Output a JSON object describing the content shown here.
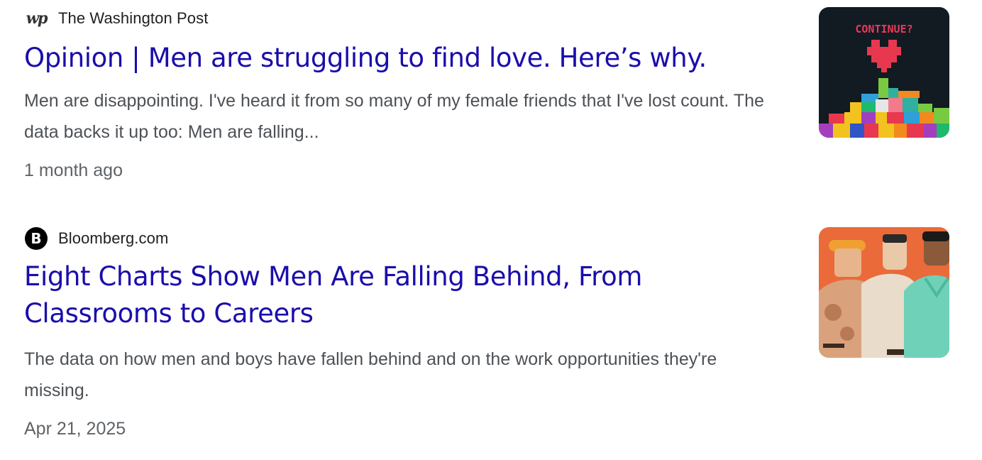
{
  "results": [
    {
      "source": "The Washington Post",
      "source_icon": "washington-post-logo",
      "headline": "Opinion | Men are struggling to find love. Here’s why.",
      "snippet": "Men are disappointing. I've heard it from so many of my female friends that I've lost count. The data backs it up too: Men are falling...",
      "date": "1 month ago",
      "thumb_text": "CONTINUE?"
    },
    {
      "source": "Bloomberg.com",
      "source_icon": "bloomberg-logo",
      "source_icon_letter": "B",
      "headline": "Eight Charts Show Men Are Falling Behind, From Classrooms to Careers",
      "snippet": "The data on how men and boys have fallen behind and on the work opportunities they're missing.",
      "date": "Apr 21, 2025"
    }
  ],
  "colors": {
    "link": "#1a0dab",
    "snippet": "#4d5156",
    "meta": "#5f6368"
  }
}
